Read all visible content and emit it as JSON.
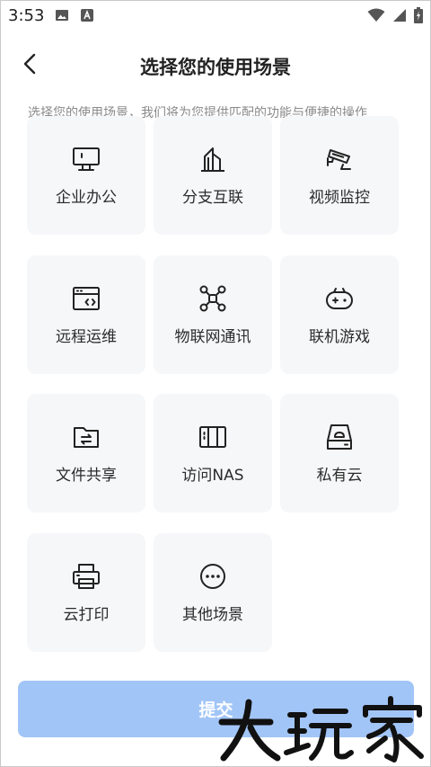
{
  "status_bar": {
    "time": "3:53",
    "left_icons": [
      "image-icon",
      "app-a-icon"
    ],
    "right_icons": [
      "wifi-icon",
      "signal-icon",
      "battery-charging-icon"
    ]
  },
  "header": {
    "title": "选择您的使用场景",
    "back_icon": "chevron-left-icon"
  },
  "subtitle": "选择您的使用场景，我们将为您提供匹配的功能与便捷的操作",
  "scenes": [
    {
      "label": "企业办公",
      "icon": "monitor-icon"
    },
    {
      "label": "分支互联",
      "icon": "buildings-icon"
    },
    {
      "label": "视频监控",
      "icon": "cctv-camera-icon"
    },
    {
      "label": "远程运维",
      "icon": "browser-code-icon"
    },
    {
      "label": "物联网通讯",
      "icon": "network-nodes-icon"
    },
    {
      "label": "联机游戏",
      "icon": "gamepad-icon"
    },
    {
      "label": "文件共享",
      "icon": "folder-share-icon"
    },
    {
      "label": "访问NAS",
      "icon": "nas-storage-icon"
    },
    {
      "label": "私有云",
      "icon": "cloud-drive-icon"
    },
    {
      "label": "云打印",
      "icon": "printer-icon"
    },
    {
      "label": "其他场景",
      "icon": "more-circle-icon"
    }
  ],
  "submit": {
    "label": "提交"
  },
  "watermark": {
    "text": "大玩家"
  },
  "colors": {
    "card_bg": "#f6f7f9",
    "submit_bg": "#a2c5f7",
    "text_primary": "#222222",
    "text_secondary": "#8a8a8a"
  }
}
